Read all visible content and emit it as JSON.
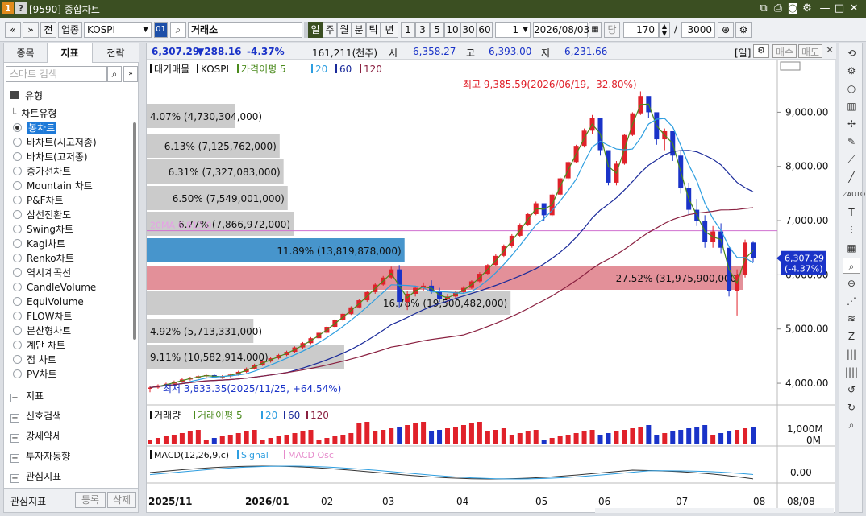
{
  "window": {
    "icon_num": "1",
    "icon_q": "?",
    "title": "[9590] 종합차트"
  },
  "toolbar": {
    "back": "«",
    "fwd": "»",
    "prev": "전",
    "sector": "업종",
    "symbol": "KOSPI",
    "code_flag": "01",
    "exchange": "거래소",
    "periods": [
      "일",
      "주",
      "월",
      "분",
      "틱",
      "년"
    ],
    "nums": [
      "1",
      "3",
      "5",
      "10",
      "30",
      "60"
    ],
    "count_sel": "1",
    "date": "2026/08/03",
    "date_unit": "당",
    "view_count": "170",
    "slash": "/",
    "total_count": "3000"
  },
  "left": {
    "tabs": [
      "종목",
      "지표",
      "전략"
    ],
    "active_tab": "지표",
    "search_placeholder": "스마트 검색",
    "section_type": "유형",
    "group_chart_type": "차트유형",
    "chart_types": [
      "봉차트",
      "바차트(시고저종)",
      "바차트(고저종)",
      "종가선차트",
      "Mountain 차트",
      "P&F차트",
      "삼선전환도",
      "Swing차트",
      "Kagi차트",
      "Renko차트",
      "역시계곡선",
      "CandleVolume",
      "EquiVolume",
      "FLOW차트",
      "분산형차트",
      "계단 차트",
      "점 차트",
      "PV차트"
    ],
    "selected_type": "봉차트",
    "sections": [
      "지표",
      "신호검색",
      "강세약세",
      "투자자동향",
      "관심지표"
    ],
    "fav_label": "관심지표",
    "register": "등록",
    "delete": "삭제"
  },
  "pricebar": {
    "price": "6,307.29",
    "change": "▼288.16",
    "pct": "-4.37%",
    "volume": "161,211(천주)",
    "open_l": "시",
    "open": "6,358.27",
    "high_l": "고",
    "high": "6,393.00",
    "low_l": "저",
    "low": "6,231.66",
    "period_badge": "[일]",
    "buy": "매수",
    "sell": "매도"
  },
  "main_legend": {
    "a": "대기매물",
    "b": "KOSPI",
    "c": "가격이평 5",
    "d": "20",
    "e": "60",
    "f": "120"
  },
  "annotations": {
    "high": "최고 9,385.59(2026/06/19, -32.80%)",
    "low": "최저 3,833.35(2025/11/25, +64.54%)",
    "ma_line": "20MA 6,813.0"
  },
  "volume_profile": [
    {
      "label": "4.07% (4,730,304,000)",
      "pct": 4.07
    },
    {
      "label": "6.13% (7,125,762,000)",
      "pct": 6.13
    },
    {
      "label": "6.31% (7,327,083,000)",
      "pct": 6.31
    },
    {
      "label": "6.50% (7,549,001,000)",
      "pct": 6.5
    },
    {
      "label": "6.77% (7,866,972,000)",
      "pct": 6.77
    },
    {
      "label": "11.89% (13,819,878,000)",
      "pct": 11.89
    },
    {
      "label": "27.52% (31,975,900,000)",
      "pct": 27.52
    },
    {
      "label": "16.78% (19,500,482,000)",
      "pct": 16.78
    },
    {
      "label": "4.92% (5,713,331,000)",
      "pct": 4.92
    },
    {
      "label": "9.11% (10,582,914,000)",
      "pct": 9.11
    }
  ],
  "y_axis": [
    "9,000.00",
    "8,000.00",
    "7,000.00",
    "6,000.00",
    "5,000.00",
    "4,000.00"
  ],
  "current_price_tag": {
    "price": "6,307.29",
    "pct": "(-4.37%)"
  },
  "vol_legend": {
    "a": "거래량",
    "b": "거래이평 5",
    "c": "20",
    "d": "60",
    "e": "120"
  },
  "vol_axis": [
    "1,000M",
    "0M"
  ],
  "macd_legend": {
    "a": "MACD(12,26,9,c)",
    "b": "Signal",
    "c": "MACD Osc"
  },
  "macd_axis": [
    "0.00"
  ],
  "x_axis": [
    "2025/11",
    "2026/01",
    "02",
    "03",
    "04",
    "05",
    "06",
    "07",
    "08"
  ],
  "x_axis_right": "08/08",
  "colors": {
    "up": "#e0212a",
    "down": "#1a33c8",
    "ma5": "#4a8a1c",
    "ma20": "#2e9ee0",
    "ma60": "#1a2a9a",
    "ma120": "#8a2040",
    "title": "#3b4f22"
  },
  "chart_data": {
    "type": "candlestick",
    "series": [
      {
        "name": "KOSPI"
      }
    ],
    "ohlc": [
      [
        3900,
        3950,
        3833,
        3920
      ],
      [
        3920,
        3980,
        3900,
        3960
      ],
      [
        3960,
        4010,
        3940,
        3990
      ],
      [
        3990,
        4050,
        3970,
        4030
      ],
      [
        4030,
        4090,
        4010,
        4070
      ],
      [
        4070,
        4120,
        4050,
        4100
      ],
      [
        4100,
        4150,
        4080,
        4130
      ],
      [
        4130,
        4170,
        4100,
        4150
      ],
      [
        4150,
        4170,
        4090,
        4110
      ],
      [
        4110,
        4150,
        4080,
        4130
      ],
      [
        4130,
        4180,
        4110,
        4160
      ],
      [
        4160,
        4230,
        4140,
        4210
      ],
      [
        4210,
        4290,
        4190,
        4270
      ],
      [
        4270,
        4360,
        4250,
        4340
      ],
      [
        4340,
        4420,
        4320,
        4400
      ],
      [
        4400,
        4480,
        4380,
        4460
      ],
      [
        4460,
        4540,
        4440,
        4520
      ],
      [
        4520,
        4600,
        4500,
        4580
      ],
      [
        4580,
        4680,
        4560,
        4660
      ],
      [
        4660,
        4760,
        4640,
        4740
      ],
      [
        4740,
        4850,
        4720,
        4830
      ],
      [
        4830,
        4950,
        4810,
        4930
      ],
      [
        4930,
        5060,
        4900,
        5040
      ],
      [
        5040,
        5180,
        5020,
        5160
      ],
      [
        5160,
        5300,
        5140,
        5280
      ],
      [
        5280,
        5420,
        5260,
        5400
      ],
      [
        5400,
        5550,
        5380,
        5530
      ],
      [
        5530,
        5700,
        5500,
        5680
      ],
      [
        5680,
        5850,
        5650,
        5820
      ],
      [
        5820,
        5980,
        5800,
        5950
      ],
      [
        5950,
        6150,
        5920,
        6100
      ],
      [
        6100,
        6180,
        5400,
        5500
      ],
      [
        5500,
        5700,
        5350,
        5650
      ],
      [
        5650,
        5800,
        5600,
        5760
      ],
      [
        5760,
        5860,
        5700,
        5800
      ],
      [
        5800,
        5900,
        5650,
        5700
      ],
      [
        5700,
        5760,
        5500,
        5550
      ],
      [
        5550,
        5650,
        5480,
        5600
      ],
      [
        5600,
        5700,
        5550,
        5680
      ],
      [
        5680,
        5790,
        5650,
        5760
      ],
      [
        5760,
        5900,
        5740,
        5880
      ],
      [
        5880,
        6050,
        5860,
        6020
      ],
      [
        6020,
        6200,
        6000,
        6180
      ],
      [
        6180,
        6380,
        6160,
        6350
      ],
      [
        6350,
        6560,
        6330,
        6530
      ],
      [
        6530,
        6750,
        6500,
        6720
      ],
      [
        6720,
        6950,
        6700,
        6920
      ],
      [
        6920,
        7150,
        6900,
        7120
      ],
      [
        7120,
        7350,
        7100,
        7320
      ],
      [
        7320,
        7250,
        7000,
        7100
      ],
      [
        7100,
        7500,
        7080,
        7480
      ],
      [
        7480,
        7800,
        7460,
        7780
      ],
      [
        7780,
        8100,
        7760,
        8080
      ],
      [
        8080,
        8400,
        8060,
        8380
      ],
      [
        8380,
        8700,
        8350,
        8660
      ],
      [
        8660,
        8950,
        8600,
        8900
      ],
      [
        8900,
        8700,
        8200,
        8300
      ],
      [
        8300,
        8250,
        7650,
        7700
      ],
      [
        7700,
        8100,
        7650,
        8050
      ],
      [
        8050,
        8600,
        8030,
        8580
      ],
      [
        8580,
        9000,
        8560,
        8980
      ],
      [
        8980,
        9385,
        8950,
        9300
      ],
      [
        9300,
        9250,
        8900,
        9000
      ],
      [
        9000,
        8900,
        8400,
        8500
      ],
      [
        8500,
        8700,
        8300,
        8650
      ],
      [
        8650,
        8600,
        8100,
        8200
      ],
      [
        8200,
        8300,
        7500,
        7600
      ],
      [
        7600,
        7700,
        7100,
        7200
      ],
      [
        7200,
        7400,
        6900,
        7000
      ],
      [
        7000,
        7100,
        6500,
        6600
      ],
      [
        6600,
        6900,
        6500,
        6800
      ],
      [
        6800,
        6950,
        6400,
        6500
      ],
      [
        6500,
        6400,
        5600,
        5700
      ],
      [
        5700,
        6100,
        5250,
        6000
      ],
      [
        6000,
        6650,
        5950,
        6595
      ],
      [
        6595,
        6610,
        6231,
        6307
      ]
    ],
    "ma": {
      "5": true,
      "20": true,
      "60": true,
      "120": true
    },
    "ylim": [
      3600,
      9600
    ]
  }
}
